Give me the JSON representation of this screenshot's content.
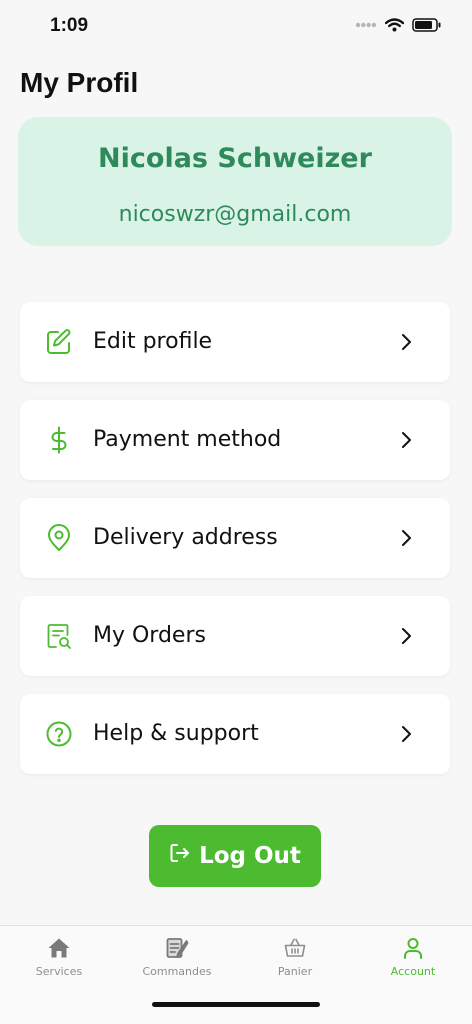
{
  "status_bar": {
    "time": "1:09",
    "icons": [
      "signal-dots-icon",
      "wifi-icon",
      "battery-icon"
    ]
  },
  "page": {
    "title": "My Profil"
  },
  "profile": {
    "name": "Nicolas Schweizer",
    "email": "nicoswzr@gmail.com"
  },
  "menu": {
    "items": [
      {
        "label": "Edit profile",
        "icon": "edit-icon"
      },
      {
        "label": "Payment method",
        "icon": "dollar-icon"
      },
      {
        "label": "Delivery address",
        "icon": "location-pin-icon"
      },
      {
        "label": "My Orders",
        "icon": "orders-search-icon"
      },
      {
        "label": "Help & support",
        "icon": "help-icon"
      }
    ]
  },
  "logout": {
    "label": "Log Out",
    "icon": "logout-icon"
  },
  "tab_bar": {
    "tabs": [
      {
        "label": "Services",
        "icon": "home-icon",
        "active": false
      },
      {
        "label": "Commandes",
        "icon": "orders-icon",
        "active": false
      },
      {
        "label": "Panier",
        "icon": "basket-icon",
        "active": false
      },
      {
        "label": "Account",
        "icon": "user-icon",
        "active": true
      }
    ]
  },
  "colors": {
    "accent": "#4cbb2f",
    "profile_card_bg": "#d9f3e6",
    "profile_text": "#2f8a5b",
    "inactive_tab": "#8e8e8e"
  }
}
